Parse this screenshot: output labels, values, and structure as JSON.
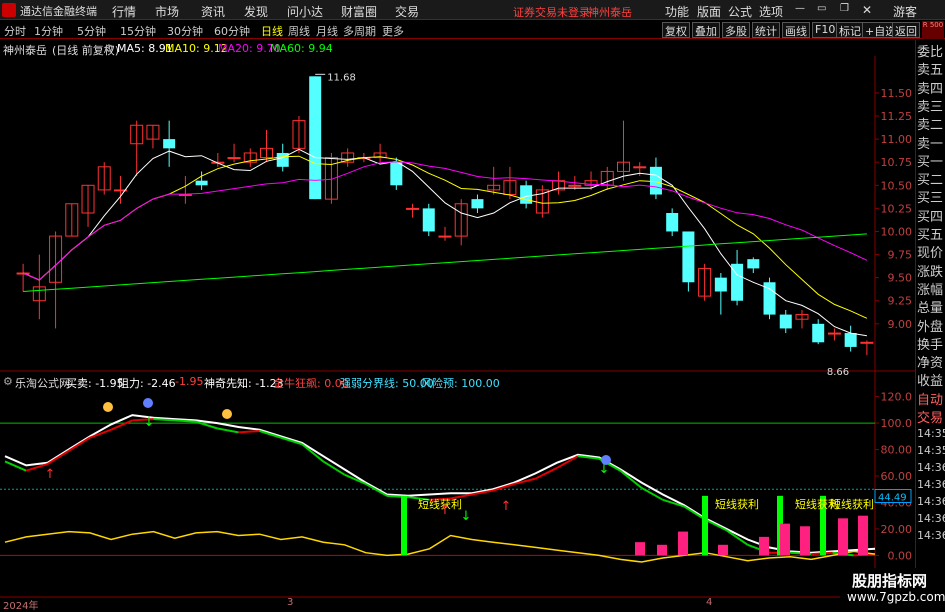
{
  "app": {
    "title": "通达信金融终端"
  },
  "menu": {
    "items": [
      "行情",
      "市场",
      "资讯",
      "发现",
      "问小达",
      "财富圈",
      "交易"
    ],
    "promo1": "证券交易未登录",
    "promo2": "神州泰岳",
    "right": [
      "功能",
      "版面",
      "公式",
      "选项"
    ],
    "guest": "游客"
  },
  "toolbar": {
    "periods": [
      "分时",
      "1分钟",
      "5分钟",
      "15分钟",
      "30分钟",
      "60分钟",
      "日线",
      "周线",
      "月线",
      "多周期",
      "更多"
    ],
    "active": "日线",
    "right": [
      "复权",
      "叠加",
      "多股",
      "统计",
      "画线",
      "F10",
      "标记",
      "+自选",
      "返回"
    ]
  },
  "stock": {
    "name": "神州泰岳",
    "mode": "(日线 前复权)",
    "ma5": "MA5: 8.91",
    "ma10": "MA10: 9.12",
    "ma20": "MA20: 9.70",
    "ma60": "MA60: 9.94",
    "high_label": "11.68",
    "low_label": "8.66"
  },
  "price_axis": [
    "11.50",
    "11.25",
    "11.00",
    "10.75",
    "10.50",
    "10.25",
    "10.00",
    "9.75",
    "9.50",
    "9.25",
    "9.00"
  ],
  "indicator": {
    "name": "乐淘公式网",
    "buysell": "买卖: -1.95",
    "resist": "阻力: -2.46",
    "val": "-1.95",
    "shenqi": "神奇先知: -1.23",
    "jinniu": "金牛狂飙: 0.00",
    "qiangruo": "强弱分界线: 50.00",
    "fengxian": "风险预: 100.00",
    "signal_label": "短线获利"
  },
  "ind_axis": [
    "120.0",
    "100.0",
    "80.00",
    "60.00",
    "40.00",
    "20.00",
    "0.00"
  ],
  "ind_current": "44.49",
  "right_panel": [
    "委比",
    "卖五",
    "卖四",
    "卖三",
    "卖二",
    "卖一",
    "买一",
    "买二",
    "买三",
    "买四",
    "买五",
    "现价",
    "涨跌",
    "涨幅",
    "总量",
    "外盘",
    "换手",
    "净资",
    "收益",
    "自动",
    "交易"
  ],
  "right_times": [
    "14:35",
    "14:35",
    "14:36",
    "14:36",
    "14:36",
    "14:36",
    "14:36"
  ],
  "right_badge": "R 500",
  "date_axis": [
    "2024年",
    "3",
    "4"
  ],
  "colors": {
    "up": "#ff3232",
    "down": "#54ffff",
    "ma5": "#ffffff",
    "ma10": "#ffff00",
    "ma20": "#ff00ff",
    "ma60": "#00ff00"
  },
  "watermark": {
    "line1": "股朋指标网",
    "line2": "www.7gpzb.com"
  },
  "chart_data": {
    "type": "candlestick",
    "ylim": [
      8.5,
      11.9
    ],
    "candles": [
      {
        "o": 9.55,
        "c": 9.55,
        "h": 9.65,
        "l": 9.35
      },
      {
        "o": 9.25,
        "c": 9.4,
        "h": 9.75,
        "l": 9.05
      },
      {
        "o": 9.45,
        "c": 9.95,
        "h": 10.0,
        "l": 8.95
      },
      {
        "o": 9.95,
        "c": 10.3,
        "h": 10.3,
        "l": 9.95
      },
      {
        "o": 10.2,
        "c": 10.5,
        "h": 10.5,
        "l": 10.05
      },
      {
        "o": 10.45,
        "c": 10.7,
        "h": 10.75,
        "l": 10.4
      },
      {
        "o": 10.45,
        "c": 10.45,
        "h": 10.6,
        "l": 10.3
      },
      {
        "o": 10.95,
        "c": 11.15,
        "h": 11.2,
        "l": 10.6
      },
      {
        "o": 11.0,
        "c": 11.15,
        "h": 11.15,
        "l": 10.9
      },
      {
        "o": 11.0,
        "c": 10.9,
        "h": 11.2,
        "l": 10.7
      },
      {
        "o": 10.4,
        "c": 10.4,
        "h": 10.6,
        "l": 10.3
      },
      {
        "o": 10.55,
        "c": 10.5,
        "h": 10.65,
        "l": 10.45
      },
      {
        "o": 10.75,
        "c": 10.75,
        "h": 10.85,
        "l": 10.7
      },
      {
        "o": 10.8,
        "c": 10.8,
        "h": 10.95,
        "l": 10.75
      },
      {
        "o": 10.75,
        "c": 10.85,
        "h": 10.9,
        "l": 10.7
      },
      {
        "o": 10.8,
        "c": 10.9,
        "h": 11.1,
        "l": 10.75
      },
      {
        "o": 10.85,
        "c": 10.7,
        "h": 10.95,
        "l": 10.65
      },
      {
        "o": 10.9,
        "c": 11.2,
        "h": 11.25,
        "l": 10.85
      },
      {
        "o": 11.68,
        "c": 10.35,
        "h": 11.68,
        "l": 10.35
      },
      {
        "o": 10.35,
        "c": 10.8,
        "h": 10.85,
        "l": 10.3
      },
      {
        "o": 10.75,
        "c": 10.85,
        "h": 10.9,
        "l": 10.7
      },
      {
        "o": 10.8,
        "c": 10.8,
        "h": 10.85,
        "l": 10.75
      },
      {
        "o": 10.8,
        "c": 10.85,
        "h": 10.95,
        "l": 10.75
      },
      {
        "o": 10.75,
        "c": 10.5,
        "h": 10.8,
        "l": 10.45
      },
      {
        "o": 10.25,
        "c": 10.25,
        "h": 10.3,
        "l": 10.15
      },
      {
        "o": 10.25,
        "c": 10.0,
        "h": 10.3,
        "l": 9.95
      },
      {
        "o": 9.95,
        "c": 9.95,
        "h": 10.05,
        "l": 9.9
      },
      {
        "o": 9.95,
        "c": 10.3,
        "h": 10.35,
        "l": 9.85
      },
      {
        "o": 10.35,
        "c": 10.25,
        "h": 10.4,
        "l": 10.2
      },
      {
        "o": 10.45,
        "c": 10.5,
        "h": 10.7,
        "l": 10.4
      },
      {
        "o": 10.4,
        "c": 10.55,
        "h": 10.7,
        "l": 10.35
      },
      {
        "o": 10.5,
        "c": 10.3,
        "h": 10.55,
        "l": 10.25
      },
      {
        "o": 10.2,
        "c": 10.45,
        "h": 10.5,
        "l": 10.15
      },
      {
        "o": 10.45,
        "c": 10.55,
        "h": 10.65,
        "l": 10.4
      },
      {
        "o": 10.5,
        "c": 10.5,
        "h": 10.6,
        "l": 10.45
      },
      {
        "o": 10.5,
        "c": 10.55,
        "h": 10.65,
        "l": 10.45
      },
      {
        "o": 10.5,
        "c": 10.65,
        "h": 10.7,
        "l": 10.45
      },
      {
        "o": 10.65,
        "c": 10.75,
        "h": 11.2,
        "l": 10.55
      },
      {
        "o": 10.7,
        "c": 10.7,
        "h": 10.75,
        "l": 10.6
      },
      {
        "o": 10.7,
        "c": 10.4,
        "h": 10.8,
        "l": 10.35
      },
      {
        "o": 10.2,
        "c": 10.0,
        "h": 10.25,
        "l": 9.95
      },
      {
        "o": 10.0,
        "c": 9.45,
        "h": 10.0,
        "l": 9.35
      },
      {
        "o": 9.3,
        "c": 9.6,
        "h": 9.65,
        "l": 9.25
      },
      {
        "o": 9.5,
        "c": 9.35,
        "h": 9.55,
        "l": 9.1
      },
      {
        "o": 9.65,
        "c": 9.25,
        "h": 9.8,
        "l": 9.2
      },
      {
        "o": 9.7,
        "c": 9.6,
        "h": 9.72,
        "l": 9.55
      },
      {
        "o": 9.45,
        "c": 9.1,
        "h": 9.5,
        "l": 9.05
      },
      {
        "o": 9.1,
        "c": 8.95,
        "h": 9.15,
        "l": 8.9
      },
      {
        "o": 9.05,
        "c": 9.1,
        "h": 9.15,
        "l": 8.95
      },
      {
        "o": 9.0,
        "c": 8.8,
        "h": 9.05,
        "l": 8.78
      },
      {
        "o": 8.9,
        "c": 8.9,
        "h": 8.95,
        "l": 8.82
      },
      {
        "o": 8.9,
        "c": 8.75,
        "h": 8.98,
        "l": 8.7
      },
      {
        "o": 8.8,
        "c": 8.8,
        "h": 8.82,
        "l": 8.66
      }
    ]
  }
}
